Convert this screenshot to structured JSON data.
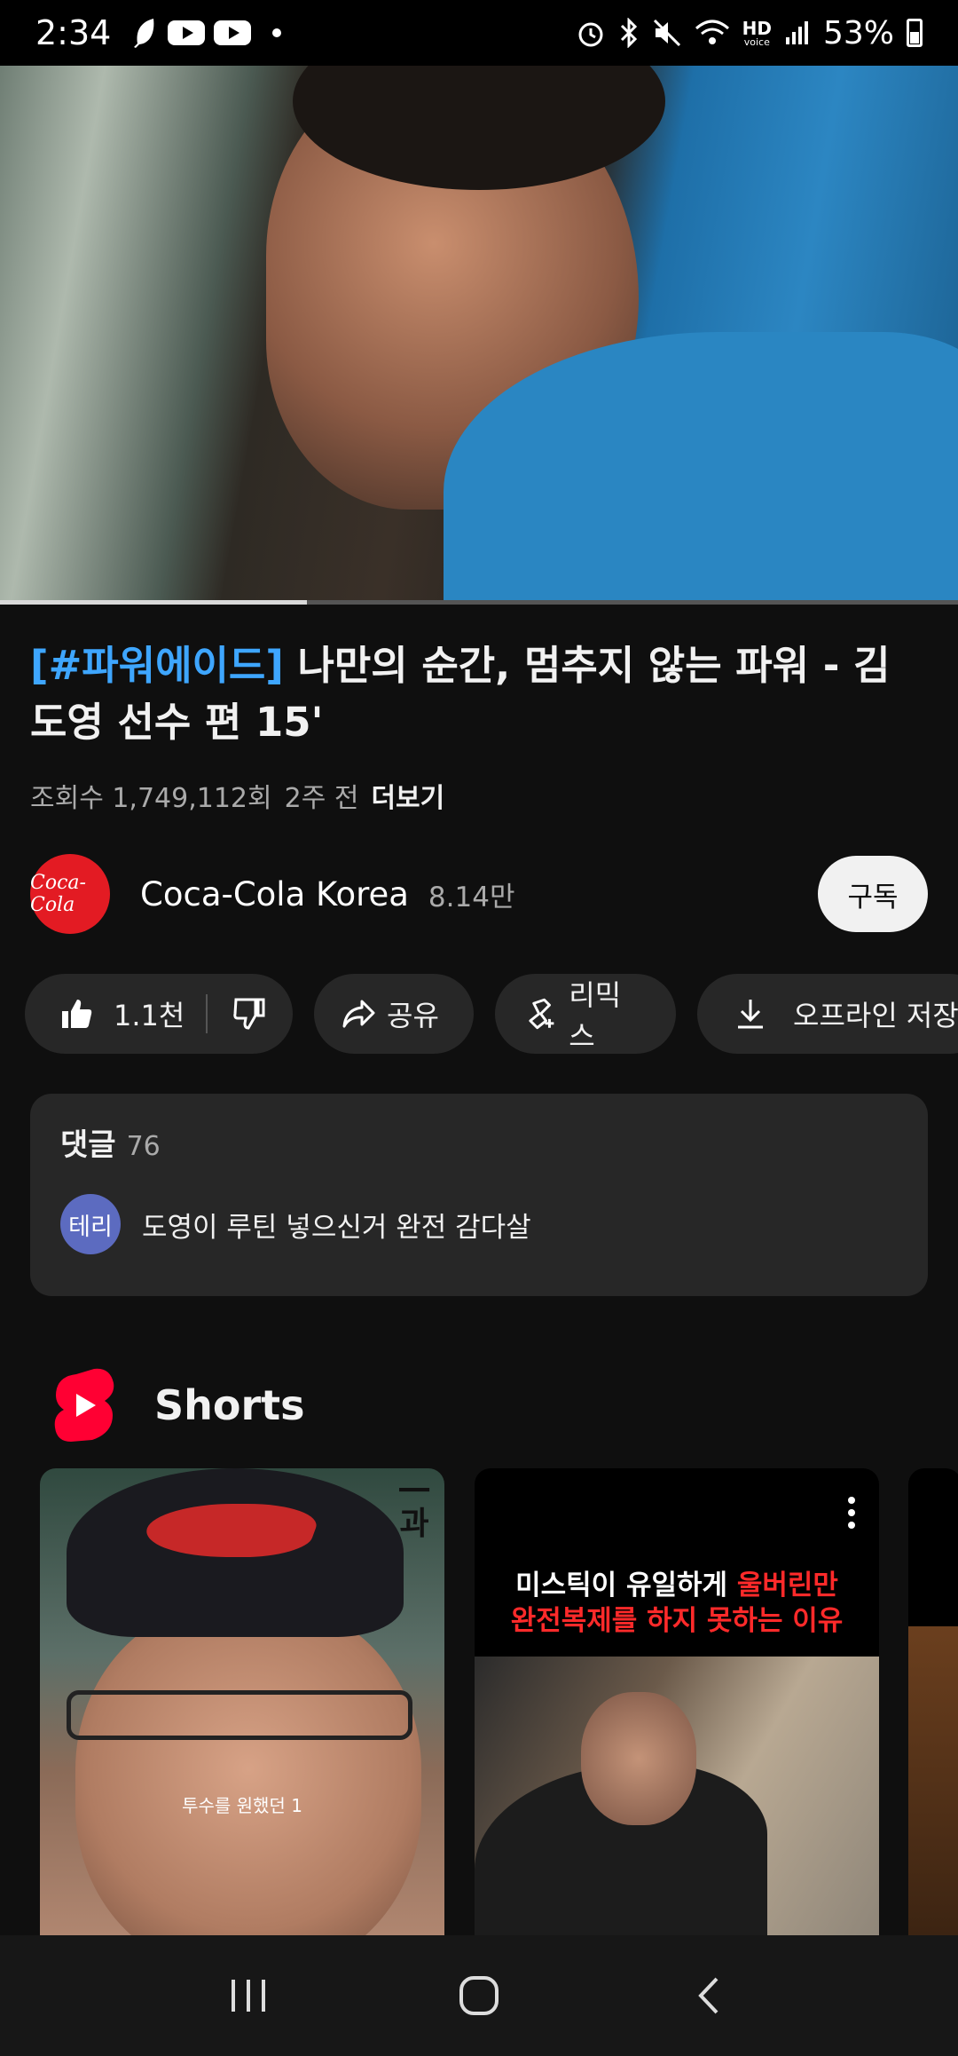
{
  "status_bar": {
    "time": "2:34",
    "battery": "53%",
    "hd_label": "HD",
    "voice_label": "voice"
  },
  "video": {
    "progress_fraction": 0.32
  },
  "title": {
    "hashtag": "[#파워에이드]",
    "text": " 나만의 순간, 멈추지 않는 파워 - 김도영 선수 편 15'"
  },
  "meta": {
    "views": "조회수 1,749,112회",
    "age": "2주 전",
    "more": "더보기"
  },
  "channel": {
    "avatar_text": "Coca-Cola",
    "name": "Coca-Cola Korea",
    "subscribers": "8.14만",
    "subscribe_label": "구독"
  },
  "actions": {
    "like_count": "1.1천",
    "share_label": "공유",
    "remix_label": "리믹스",
    "offline_label": "오프라인 저장"
  },
  "comments": {
    "title": "댓글",
    "count": "76",
    "top_comment": {
      "avatar_text": "테리",
      "text": "도영이 루틴 넣으신거 완전 감다살"
    }
  },
  "shorts": {
    "section_title": "Shorts",
    "items": [
      {
        "subtitle": "투수를 원했던 1 ",
        "corner_mark": "一과"
      },
      {
        "line1_white": "미스틱이 유일하게 ",
        "line1_red": "울버린만",
        "line2": "완전복제를 하지 못하는 이유"
      }
    ]
  },
  "colors": {
    "background": "#0f0f0f",
    "accent_blue": "#3ea6ff",
    "brand_red": "#e31b23",
    "card": "#272727"
  }
}
